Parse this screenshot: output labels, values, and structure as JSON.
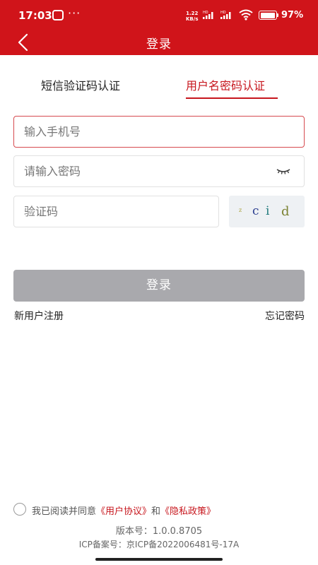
{
  "status_bar": {
    "time": "17:03",
    "more": "···",
    "speed_value": "1.22",
    "speed_unit": "KB/s",
    "battery": "97%"
  },
  "header": {
    "title": "登录"
  },
  "tabs": [
    {
      "label": "短信验证码认证",
      "selected": false
    },
    {
      "label": "用户名密码认证",
      "selected": true
    }
  ],
  "form": {
    "phone_placeholder": "输入手机号",
    "password_placeholder": "请输入密码",
    "captcha_placeholder": "验证码",
    "captcha_chars": [
      "z",
      "c",
      "i",
      "d"
    ],
    "login_label": "登录"
  },
  "links": {
    "register": "新用户注册",
    "forgot": "忘记密码"
  },
  "agreement": {
    "prefix": "我已阅读并同意",
    "user_agreement": "《用户协议》",
    "conj": "和",
    "privacy_policy": "《隐私政策》"
  },
  "footer": {
    "version": "版本号：1.0.0.8705",
    "icp": "ICP备案号：京ICP备2022006481号-17A"
  },
  "colors": {
    "brand_red": "#d0141a",
    "disabled_button": "#a9a9ad"
  }
}
